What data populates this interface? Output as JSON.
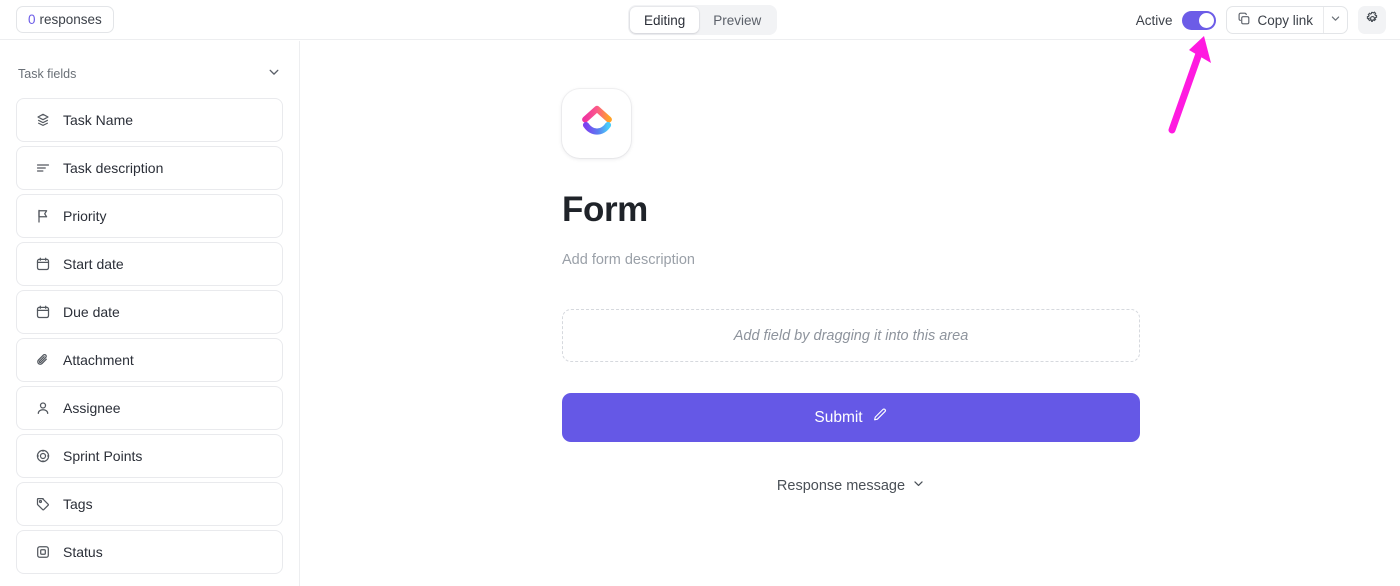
{
  "topbar": {
    "responses": {
      "count": "0",
      "label": "responses"
    },
    "tabs": [
      {
        "label": "Editing",
        "active": true
      },
      {
        "label": "Preview",
        "active": false
      }
    ],
    "active_toggle": {
      "label": "Active",
      "state": "on"
    },
    "copy_link": {
      "label": "Copy link",
      "icon": "copy-icon",
      "caret_icon": "chevron-down-icon"
    },
    "settings": {
      "icon": "gear-icon"
    }
  },
  "sidebar": {
    "section_title": "Task fields",
    "collapse_icon": "chevron-down-icon",
    "fields": [
      {
        "label": "Task Name",
        "icon": "layers-icon"
      },
      {
        "label": "Task description",
        "icon": "text-lines-icon"
      },
      {
        "label": "Priority",
        "icon": "flag-icon"
      },
      {
        "label": "Start date",
        "icon": "calendar-icon"
      },
      {
        "label": "Due date",
        "icon": "calendar-icon"
      },
      {
        "label": "Attachment",
        "icon": "paperclip-icon"
      },
      {
        "label": "Assignee",
        "icon": "user-icon"
      },
      {
        "label": "Sprint Points",
        "icon": "target-icon"
      },
      {
        "label": "Tags",
        "icon": "tag-icon"
      },
      {
        "label": "Status",
        "icon": "status-square-icon"
      }
    ]
  },
  "form": {
    "logo_icon": "clickup-logo-icon",
    "title": "Form",
    "description_placeholder": "Add form description",
    "dropzone_text": "Add field by dragging it into this area",
    "submit_label": "Submit",
    "submit_edit_icon": "pencil-icon",
    "response_message_label": "Response message",
    "response_message_icon": "chevron-down-icon"
  },
  "annotation": {
    "arrow_icon": "arrow-up-right-icon",
    "color": "#ff1ae0",
    "points_to": "active-toggle"
  },
  "colors": {
    "accent_purple": "#6558e7",
    "toggle_on": "#6c5ce7",
    "text_primary": "#2b2f38",
    "text_muted": "#9aa0a8",
    "border": "#e9eaed",
    "annotation_pink": "#ff1ae0"
  }
}
